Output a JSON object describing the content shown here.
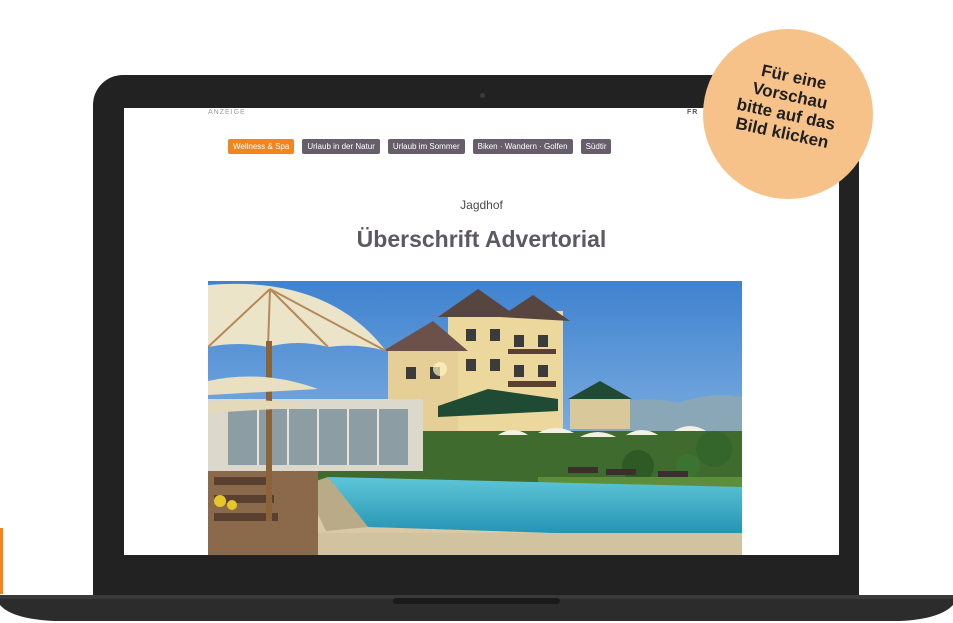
{
  "ad_label": "ANZEIGE",
  "top_right_label": "FR",
  "tabs": [
    {
      "label": "Wellness & Spa",
      "active": true
    },
    {
      "label": "Urlaub in der Natur",
      "active": false
    },
    {
      "label": "Urlaub im Sommer",
      "active": false
    },
    {
      "label": "Biken · Wandern · Golfen",
      "active": false
    },
    {
      "label": "Südtir",
      "active": false
    }
  ],
  "hotel_name": "Jagdhof",
  "headline": "Überschrift Advertorial",
  "preview_badge": {
    "lines": [
      "Für eine",
      "Vorschau",
      "bitte auf das",
      "Bild klicken"
    ]
  },
  "colors": {
    "accent": "#f2851e",
    "tab_bg": "#675d6b",
    "badge": "#f7c28a",
    "laptop": "#222222"
  }
}
